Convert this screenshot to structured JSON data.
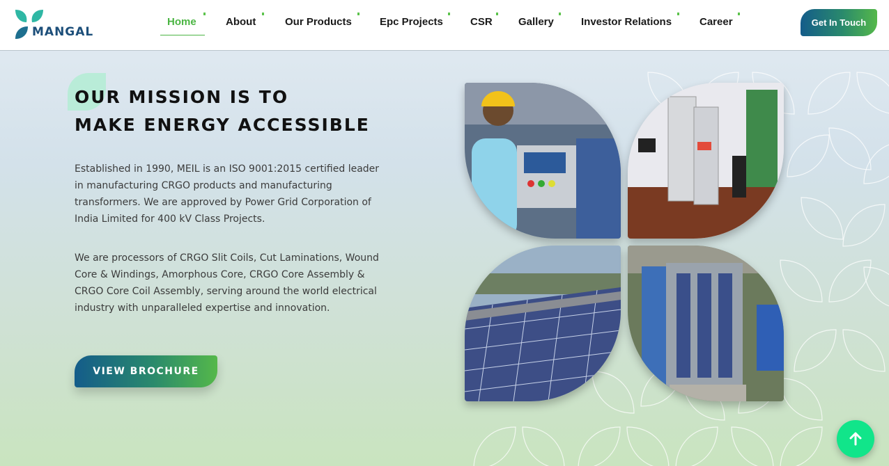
{
  "brand": {
    "name": "MANGAL",
    "logo_icon": "leaf-logo-icon"
  },
  "nav": {
    "items": [
      {
        "label": "Home",
        "active": true
      },
      {
        "label": "About"
      },
      {
        "label": "Our Products"
      },
      {
        "label": "Epc Projects"
      },
      {
        "label": "CSR"
      },
      {
        "label": "Gallery"
      },
      {
        "label": "Investor Relations"
      },
      {
        "label": "Career"
      }
    ],
    "cta_label": "Get In Touch"
  },
  "hero": {
    "headline_line1": "Our Mission is to",
    "headline_line2": "Make Energy Accessible",
    "paragraph1": "Established in 1990, MEIL is an ISO 9001:2015 certified leader in manufacturing CRGO products and manufacturing transformers. We are approved by Power Grid Corporation of India Limited for 400 kV Class Projects.",
    "paragraph2": "We are processors of CRGO Slit Coils, Cut Laminations, Wound Core & Windings, Amorphous Core, CRGO Core Assembly & CRGO Core Coil Assembly, serving around the world electrical industry with unparalleled expertise and innovation.",
    "button_label": "View Brochure"
  },
  "gallery": {
    "images": [
      "factory-worker-photo",
      "testing-lab-photo",
      "solar-rooftop-photo",
      "aerial-factory-photo"
    ]
  },
  "colors": {
    "accent_green": "#4bb543",
    "gradient_blue": "#145c8a",
    "scroll_button": "#11e58a"
  },
  "scroll_top_icon": "arrow-up-icon"
}
